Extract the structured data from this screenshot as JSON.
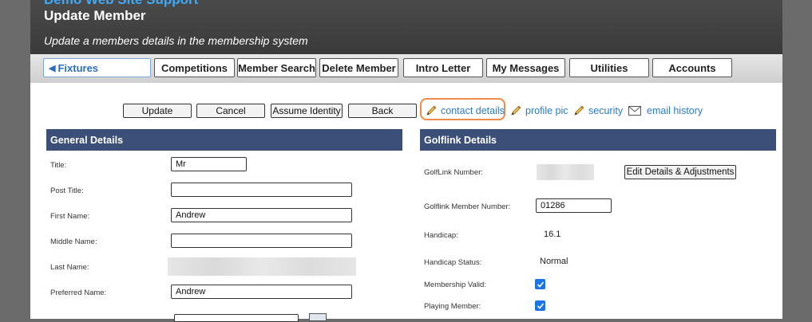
{
  "header": {
    "site_title": "Demo Web Site Support",
    "page_title": "Update Member",
    "subtitle": "Update a members details in the membership system"
  },
  "nav": {
    "items": [
      "Fixtures",
      "Competitions",
      "Member Search",
      "Delete Member",
      "Intro Letter",
      "My Messages",
      "Utilities",
      "Accounts"
    ]
  },
  "actions": {
    "update": "Update",
    "cancel": "Cancel",
    "assume_identity": "Assume Identity",
    "back": "Back"
  },
  "links": {
    "contact_details": "contact details",
    "profile_pic": "profile pic",
    "security": "security",
    "email_history": "email history"
  },
  "general": {
    "heading": "General Details",
    "title_label": "Title:",
    "title_value": "Mr",
    "post_title_label": "Post Title:",
    "post_title_value": "",
    "first_name_label": "First Name:",
    "first_name_value": "Andrew",
    "middle_name_label": "Middle Name:",
    "middle_name_value": "",
    "last_name_label": "Last Name:",
    "preferred_name_label": "Preferred Name:",
    "preferred_name_value": "Andrew"
  },
  "golflink": {
    "heading": "Golflink Details",
    "number_label": "GolfLink Number:",
    "edit_button": "Edit Details & Adjustments",
    "member_number_label": "Golflink Member Number:",
    "member_number_value": "01286",
    "handicap_label": "Handicap:",
    "handicap_value": "16.1",
    "status_label": "Handicap Status:",
    "status_value": "Normal",
    "valid_label": "Membership Valid:",
    "playing_label": "Playing Member:"
  },
  "colors": {
    "section_header": "#3c4f78",
    "link": "#2b7bc4",
    "highlight": "#f08a4b",
    "checkbox": "#1a73e8"
  }
}
